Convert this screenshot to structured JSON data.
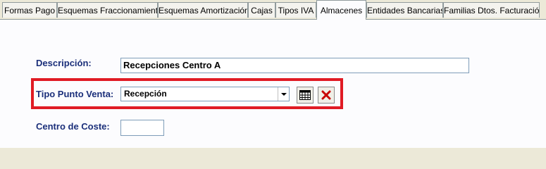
{
  "tabs": [
    {
      "label": "Formas Pago",
      "active": false
    },
    {
      "label": "Esquemas Fraccionamiento",
      "active": false
    },
    {
      "label": "Esquemas Amortización",
      "active": false
    },
    {
      "label": "Cajas",
      "active": false
    },
    {
      "label": "Tipos IVA",
      "active": false
    },
    {
      "label": "Almacenes",
      "active": true
    },
    {
      "label": "Entidades Bancarias",
      "active": false
    },
    {
      "label": "Familias Dtos. Facturación",
      "active": false
    }
  ],
  "form": {
    "descripcion_label": "Descripción:",
    "descripcion_value": "Recepciones Centro A",
    "tipo_punto_venta_label": "Tipo Punto Venta:",
    "tipo_punto_venta_value": "Recepción",
    "centro_coste_label": "Centro de Coste:",
    "centro_coste_value": ""
  },
  "icons": {
    "calendar_button": "calendar-grid-icon",
    "clear_button": "red-x-icon"
  },
  "colors": {
    "label": "#1b2f7a",
    "highlight": "#e01b24"
  }
}
